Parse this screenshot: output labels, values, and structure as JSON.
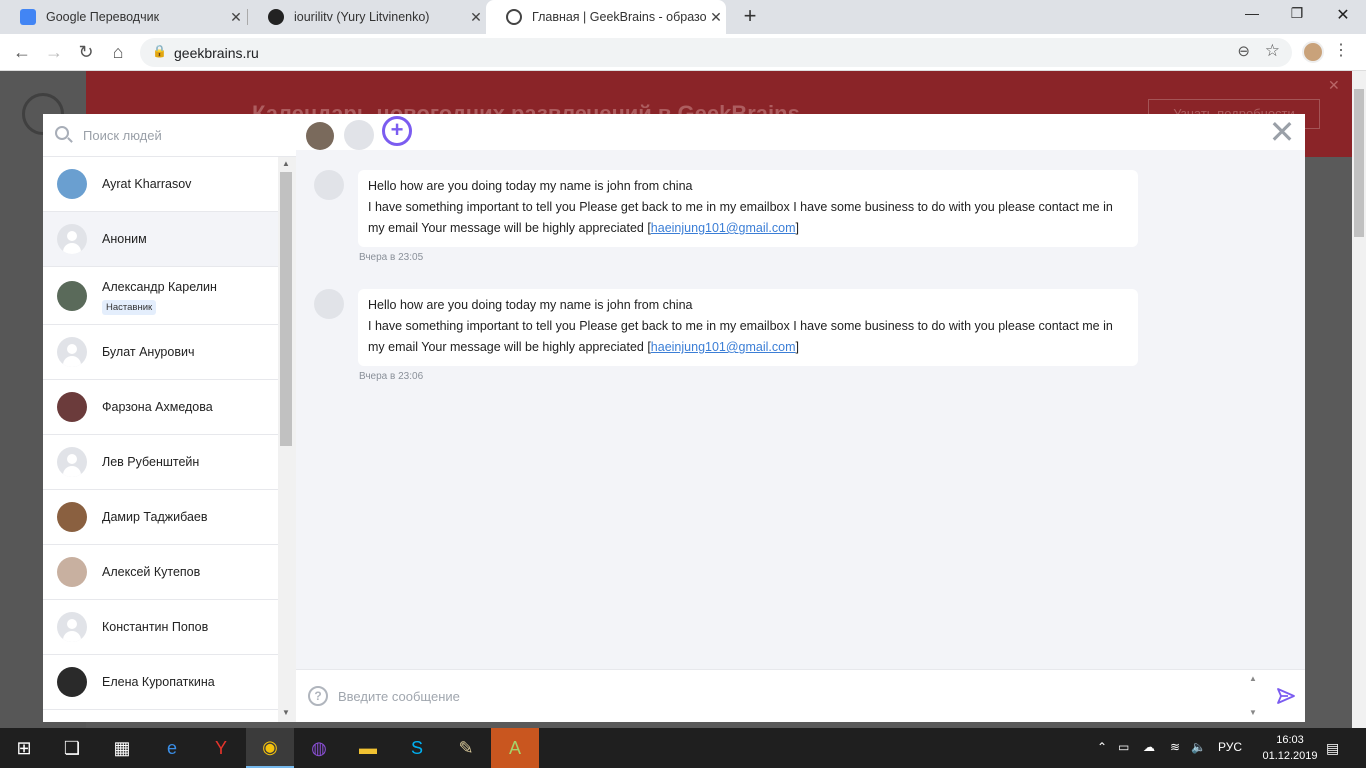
{
  "browser": {
    "tabs": [
      {
        "title": "Google Переводчик",
        "icon": "google-translate-icon",
        "color": "#4285f4"
      },
      {
        "title": "iourilitv (Yury Litvinenko)",
        "icon": "github-icon",
        "color": "#222222"
      },
      {
        "title": "Главная | GeekBrains - образова",
        "icon": "geekbrains-icon",
        "color": "#444444"
      }
    ],
    "new_tab": "+",
    "url": "geekbrains.ru",
    "window": {
      "minimize": "—",
      "maximize": "❐",
      "close": "✕"
    }
  },
  "page": {
    "banner_text": "Календарь новогодних развлечений в GeekBrains",
    "banner_button": "Узнать подробности"
  },
  "contacts": {
    "search_placeholder": "Поиск людей",
    "items": [
      {
        "name": "Ayrat Kharrasov",
        "avatar": "photo",
        "color": "#6a9fd0"
      },
      {
        "name": "Аноним",
        "avatar": "placeholder",
        "selected": true
      },
      {
        "name": "Александр Карелин",
        "avatar": "photo",
        "color": "#5a6a5a",
        "badge": "Наставник"
      },
      {
        "name": "Булат Анурович",
        "avatar": "placeholder"
      },
      {
        "name": "Фарзона Ахмедова",
        "avatar": "photo",
        "color": "#6b3b3b"
      },
      {
        "name": "Лев Рубенштейн",
        "avatar": "placeholder"
      },
      {
        "name": "Дамир Таджибаев",
        "avatar": "photo",
        "color": "#8a6040"
      },
      {
        "name": "Алексей Кутепов",
        "avatar": "photo",
        "color": "#c8b0a0"
      },
      {
        "name": "Константин Попов",
        "avatar": "placeholder"
      },
      {
        "name": "Елена Куропаткина",
        "avatar": "photo",
        "color": "#2a2a2a"
      }
    ]
  },
  "chat": {
    "add_participant": "+",
    "close": "✕",
    "messages": [
      {
        "line1": "Hello how are you doing today my name is john from china",
        "line2": "I have something important to tell you Please get back to me in my emailbox I have some business to do with you please contact me in",
        "line3_prefix": "my email Your message will be highly appreciated [",
        "email": "haeinjung101@gmail.com",
        "line3_suffix": "]",
        "time": "Вчера в 23:05"
      },
      {
        "line1": "Hello how are you doing today my name is john from china",
        "line2": "I have something important to tell you Please get back to me in my emailbox I have some business to do with you please contact me in",
        "line3_prefix": "my email Your message will be highly appreciated [",
        "email": "haeinjung101@gmail.com",
        "line3_suffix": "]",
        "time": "Вчера в 23:06"
      }
    ],
    "input_placeholder": "Введите сообщение",
    "help": "?"
  },
  "taskbar": {
    "lang": "РУС",
    "time": "16:03",
    "date": "01.12.2019"
  },
  "colors": {
    "accent": "#7b5cf0",
    "link": "#3b7ed6",
    "banner": "#8a2428"
  }
}
